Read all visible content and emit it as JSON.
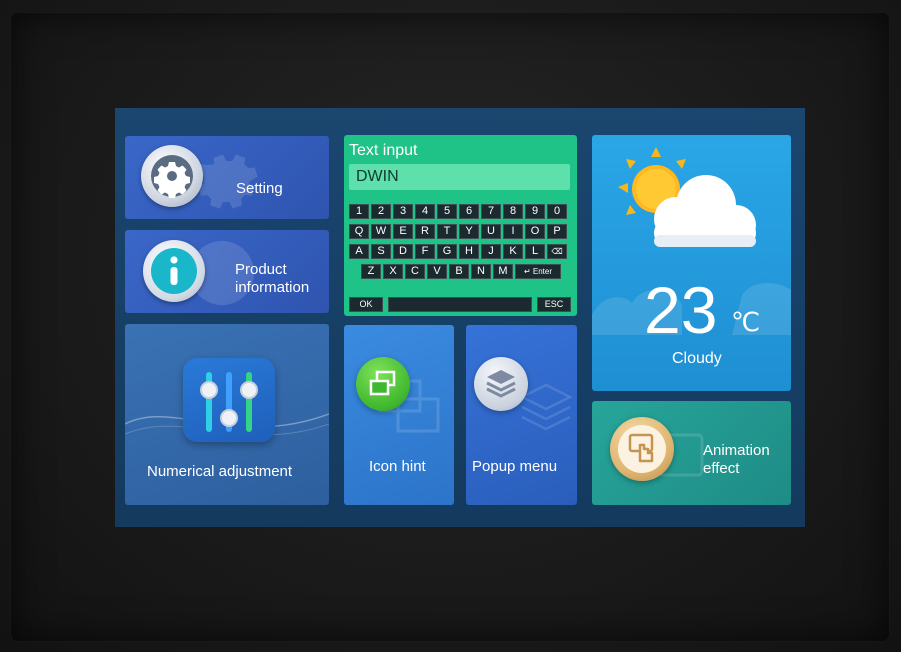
{
  "tiles": {
    "setting": {
      "label": "Setting",
      "icon": "gear-icon"
    },
    "product": {
      "label_line1": "Product",
      "label_line2": "information",
      "icon": "info-icon"
    },
    "numeric": {
      "label": "Numerical adjustment",
      "icon": "sliders-icon"
    },
    "text_input": {
      "title": "Text input",
      "value": "DWIN",
      "rows": [
        [
          "1",
          "2",
          "3",
          "4",
          "5",
          "6",
          "7",
          "8",
          "9",
          "0"
        ],
        [
          "Q",
          "W",
          "E",
          "R",
          "T",
          "Y",
          "U",
          "I",
          "O",
          "P"
        ],
        [
          "A",
          "S",
          "D",
          "F",
          "G",
          "H",
          "J",
          "K",
          "L",
          "⌫"
        ],
        [
          "Z",
          "X",
          "C",
          "V",
          "B",
          "N",
          "M",
          "↵ Enter"
        ]
      ],
      "ok_label": "OK",
      "esc_label": "ESC"
    },
    "icon_hint": {
      "label": "Icon hint",
      "icon": "windows-icon"
    },
    "popup_menu": {
      "label": "Popup menu",
      "icon": "layers-icon"
    },
    "weather": {
      "temperature": "23",
      "unit": "℃",
      "condition": "Cloudy",
      "icon": "partly-cloudy-icon"
    },
    "animation": {
      "label_line1": "Animation",
      "label_line2": "effect",
      "icon": "touch-screen-icon"
    }
  },
  "colors": {
    "screen_bg": "#173f66",
    "tile_blue": "#2f54b0",
    "tile_green": "#1fc287",
    "tile_sky": "#2aa6e6",
    "tile_teal": "#1e8c86"
  }
}
